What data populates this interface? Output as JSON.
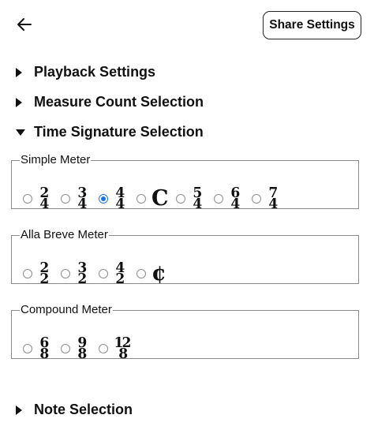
{
  "header": {
    "back_icon": "arrow-left-icon",
    "share_label": "Share Settings"
  },
  "sections": [
    {
      "label": "Playback Settings",
      "expanded": false
    },
    {
      "label": "Measure Count Selection",
      "expanded": false
    },
    {
      "label": "Time Signature Selection",
      "expanded": true
    },
    {
      "label": "Note Selection",
      "expanded": false
    }
  ],
  "meters": {
    "simple": {
      "legend": "Simple Meter",
      "options": [
        {
          "top": "2",
          "bottom": "4",
          "checked": false
        },
        {
          "top": "3",
          "bottom": "4",
          "checked": false
        },
        {
          "top": "4",
          "bottom": "4",
          "checked": true
        },
        {
          "symbol": "C",
          "name": "common-time",
          "checked": false
        },
        {
          "top": "5",
          "bottom": "4",
          "checked": false
        },
        {
          "top": "6",
          "bottom": "4",
          "checked": false
        },
        {
          "top": "7",
          "bottom": "4",
          "checked": false
        }
      ]
    },
    "alla_breve": {
      "legend": "Alla Breve Meter",
      "options": [
        {
          "top": "2",
          "bottom": "2",
          "checked": false
        },
        {
          "top": "3",
          "bottom": "2",
          "checked": false
        },
        {
          "top": "4",
          "bottom": "2",
          "checked": false
        },
        {
          "symbol": "¢",
          "name": "cut-time",
          "checked": false
        }
      ]
    },
    "compound": {
      "legend": "Compound Meter",
      "options": [
        {
          "top": "6",
          "bottom": "8",
          "checked": false
        },
        {
          "top": "9",
          "bottom": "8",
          "checked": false
        },
        {
          "top": "12",
          "bottom": "8",
          "checked": false
        }
      ]
    }
  },
  "colors": {
    "accent": "#1a73e8",
    "border": "#8a8a8a",
    "text": "#111111"
  }
}
